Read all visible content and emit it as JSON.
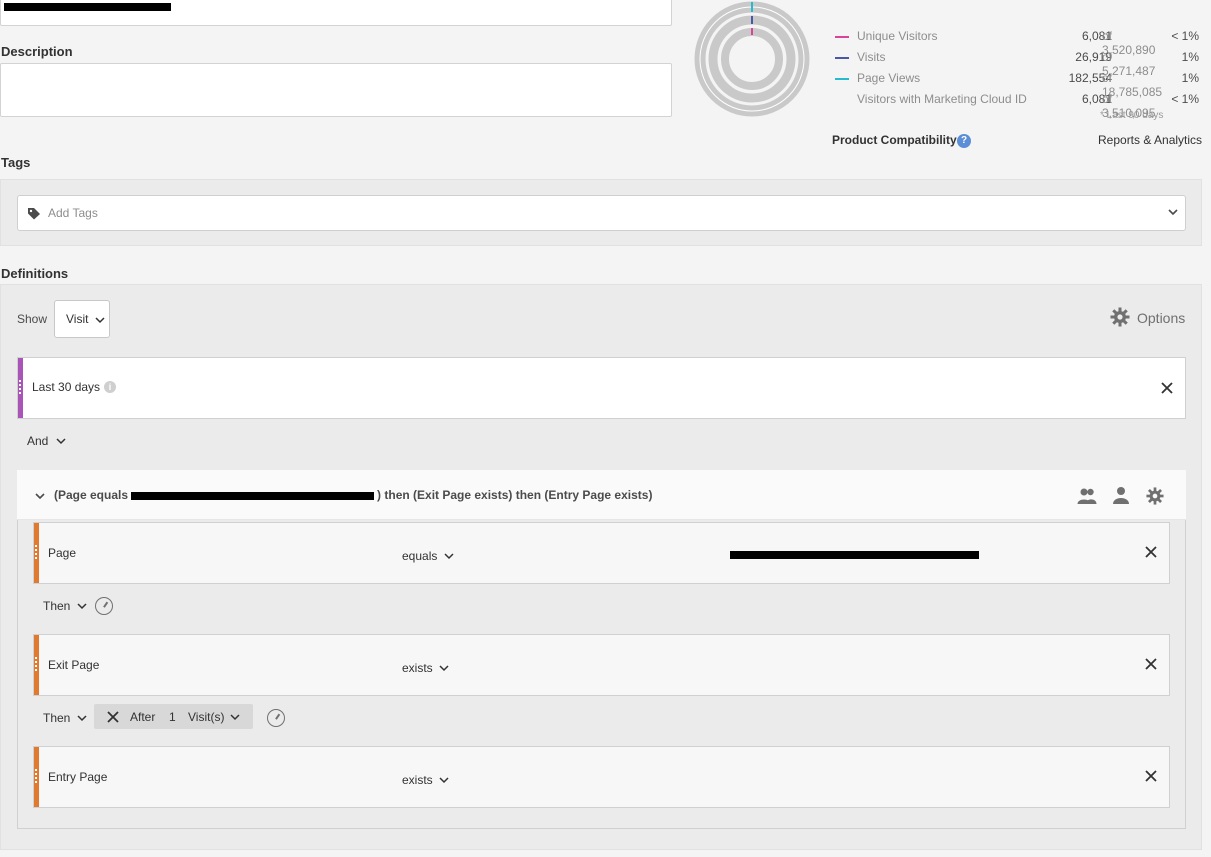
{
  "form": {
    "description_label": "Description",
    "tags_label": "Tags",
    "tags_placeholder": "Add Tags",
    "definitions_label": "Definitions"
  },
  "summary": {
    "metrics": [
      {
        "label": "Unique Visitors",
        "value": "6,081",
        "of": "of 3,520,890",
        "pct": "< 1%",
        "color": "#d9449a"
      },
      {
        "label": "Visits",
        "value": "26,919",
        "of": "of 5,271,487",
        "pct": "1%",
        "color": "#4a56a6"
      },
      {
        "label": "Page Views",
        "value": "182,554",
        "of": "of 18,785,085",
        "pct": "1%",
        "color": "#27b9cf"
      },
      {
        "label": "Visitors with Marketing Cloud ID",
        "value": "6,081",
        "of": "of 3,510,095",
        "pct": "< 1%",
        "color": ""
      }
    ],
    "footnote": "* Last 90 days",
    "product_compatibility_label": "Product Compatibility",
    "product_compatibility_value": "Reports & Analytics"
  },
  "definitions": {
    "show_label": "Show",
    "show_value": "Visit",
    "options_label": "Options",
    "date_range": "Last 30 days",
    "and_label": "And",
    "container_title_prefix": "(Page equals",
    "container_title_suffix": ") then (Exit Page exists) then (Entry Page exists)",
    "rules": [
      {
        "dimension": "Page",
        "operator": "equals"
      },
      {
        "dimension": "Exit Page",
        "operator": "exists"
      },
      {
        "dimension": "Entry Page",
        "operator": "exists"
      }
    ],
    "then_label": "Then",
    "after_label": "After",
    "after_count": "1",
    "after_unit": "Visit(s)"
  },
  "colors": {
    "date_stripe": "#a955b8",
    "rule_stripe": "#e07a30",
    "help": "#5b8ed6"
  }
}
